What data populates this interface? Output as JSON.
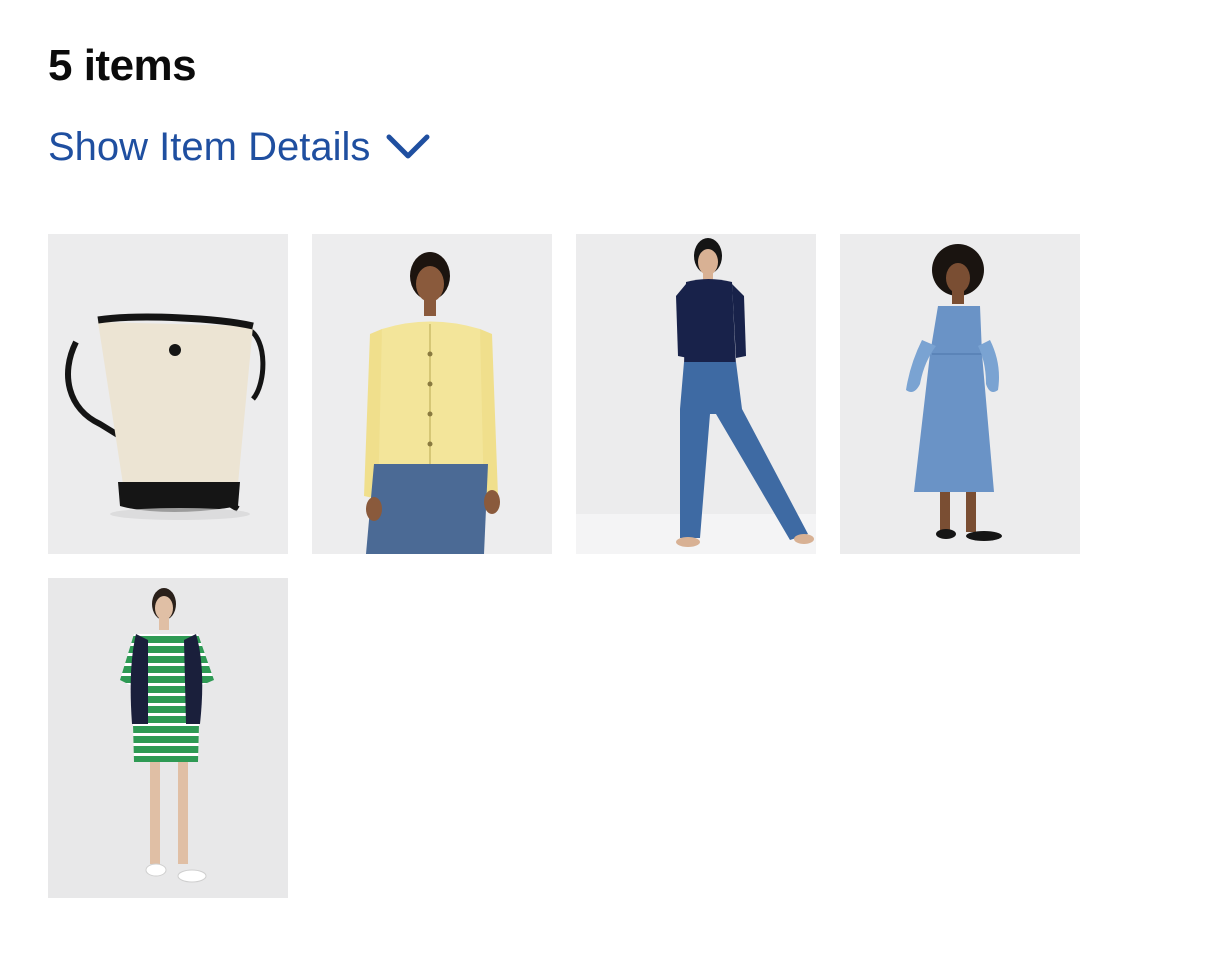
{
  "header": {
    "count_label": "5 items"
  },
  "details_toggle": {
    "label": "Show Item Details",
    "icon": "chevron-down-icon",
    "color": "#1f4fa0"
  },
  "items": [
    {
      "product": "bucket-bag",
      "colors": {
        "body": "#ece4d3",
        "trim": "#121212"
      }
    },
    {
      "product": "yellow-cardigan",
      "colors": {
        "top": "#f3e59a",
        "bottom": "#4b6a95"
      }
    },
    {
      "product": "navy-top-wide-jeans",
      "colors": {
        "top": "#18224a",
        "bottom": "#3e6aa3"
      }
    },
    {
      "product": "chambray-midi-dress",
      "colors": {
        "dress": "#6a93c6"
      }
    },
    {
      "product": "striped-tshirt-dress",
      "colors": {
        "stripe_a": "#2e9a54",
        "stripe_b": "#ffffff",
        "sweater": "#1a1f3b"
      }
    }
  ]
}
